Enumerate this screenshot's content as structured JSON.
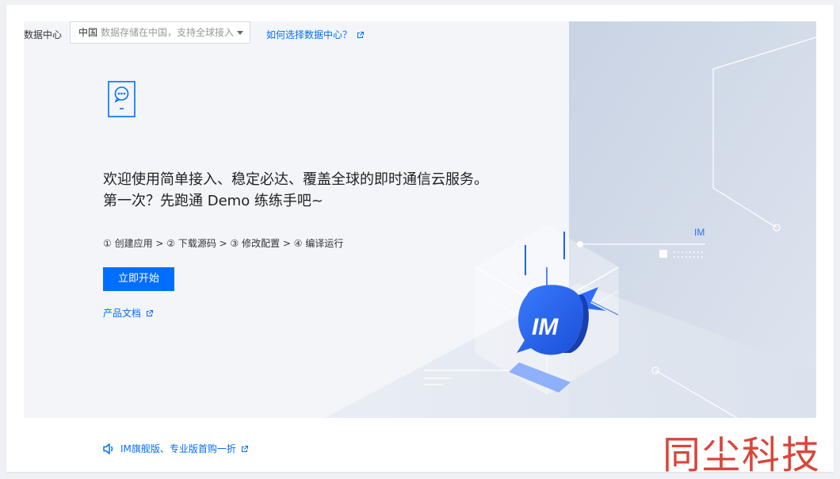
{
  "data_center": {
    "label": "数据中心",
    "selected_value": "中国",
    "selected_hint": "数据存储在中国，支持全球接入",
    "help_link": "如何选择数据中心？"
  },
  "hero": {
    "headline_line1": "欢迎使用简单接入、稳定必达、覆盖全球的即时通信云服务。",
    "headline_line2": "第一次？先跑通 Demo 练练手吧~",
    "steps": "① 创建应用 > ② 下载源码 > ③ 修改配置 > ④ 编译运行",
    "start_button": "立即开始",
    "docs_link": "产品文档",
    "illustration_badge": "IM",
    "illustration_label": "IM"
  },
  "footer": {
    "promo": "IM旗舰版、专业版首购一折"
  },
  "watermark": "同尘科技",
  "colors": {
    "accent": "#006eff",
    "watermark": "#d9463b",
    "hero_bg": "#f3f5f9"
  }
}
